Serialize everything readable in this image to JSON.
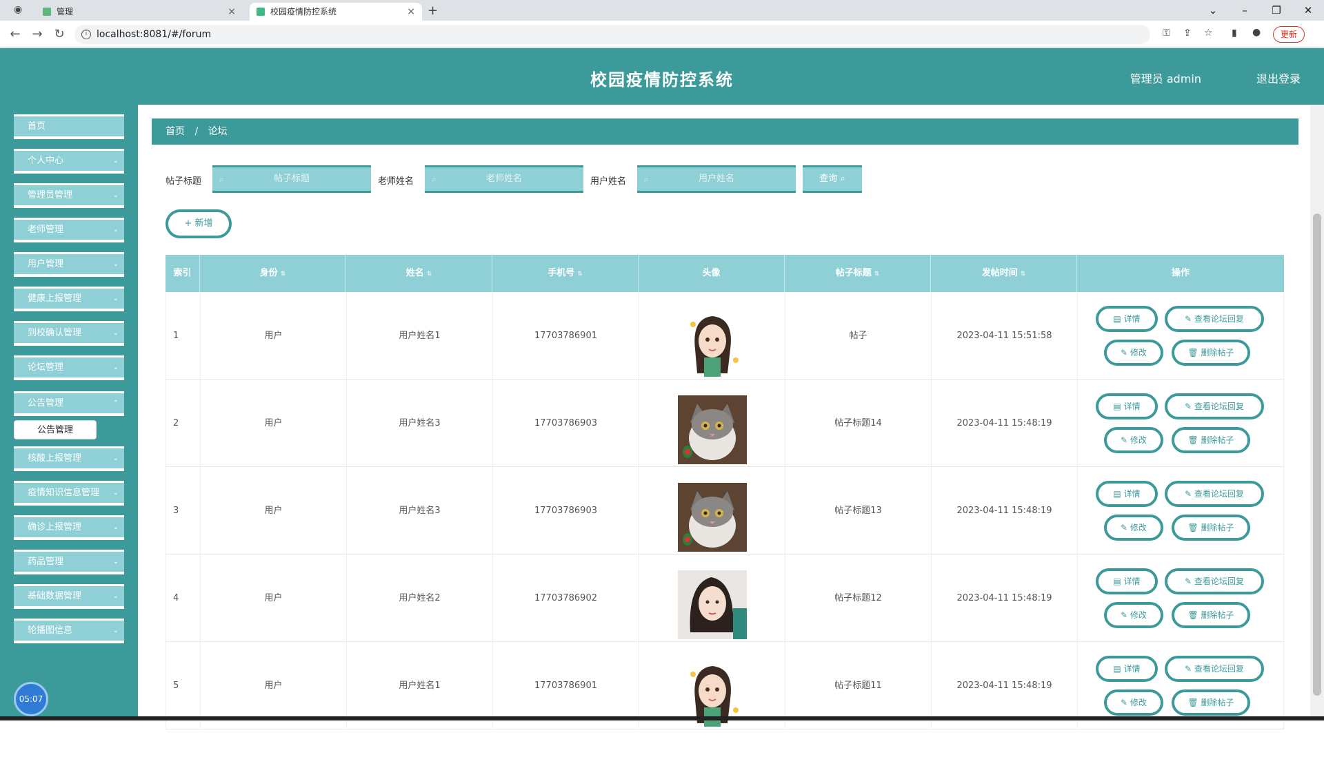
{
  "browser": {
    "tabs": [
      {
        "label": "管理",
        "active": false
      },
      {
        "label": "校园疫情防控系统",
        "active": true
      }
    ],
    "url": "localhost:8081/#/forum",
    "update_label": "更新",
    "new_tab_glyph": "+"
  },
  "header": {
    "title": "校园疫情防控系统",
    "admin_label": "管理员 admin",
    "logout_label": "退出登录"
  },
  "sidebar": {
    "items": [
      {
        "label": "首页",
        "has_children": false
      },
      {
        "label": "个人中心",
        "has_children": true
      },
      {
        "label": "管理员管理",
        "has_children": true
      },
      {
        "label": "老师管理",
        "has_children": true
      },
      {
        "label": "用户管理",
        "has_children": true
      },
      {
        "label": "健康上报管理",
        "has_children": true
      },
      {
        "label": "到校确认管理",
        "has_children": true
      },
      {
        "label": "论坛管理",
        "has_children": true
      },
      {
        "label": "公告管理",
        "has_children": true
      },
      {
        "label": "核酸上报管理",
        "has_children": true
      },
      {
        "label": "疫情知识信息管理",
        "has_children": true
      },
      {
        "label": "确诊上报管理",
        "has_children": true
      },
      {
        "label": "药品管理",
        "has_children": true
      },
      {
        "label": "基础数据管理",
        "has_children": true
      },
      {
        "label": "轮播图信息",
        "has_children": true
      }
    ],
    "open_submenu": "公告管理",
    "clock": "05:07"
  },
  "breadcrumb": {
    "home": "首页",
    "separator": "/",
    "current": "论坛"
  },
  "search": {
    "title_label": "帖子标题",
    "title_placeholder": "帖子标题",
    "teacher_label": "老师姓名",
    "teacher_placeholder": "老师姓名",
    "user_label": "用户姓名",
    "user_placeholder": "用户姓名",
    "button_label": "查询"
  },
  "add_button": "新增",
  "table": {
    "columns": [
      "索引",
      "身份",
      "姓名",
      "手机号",
      "头像",
      "帖子标题",
      "发帖时间",
      "操作"
    ],
    "rows": [
      {
        "index": "1",
        "role": "用户",
        "name": "用户姓名1",
        "phone": "17703786901",
        "avatar": "girl-avatar",
        "title": "帖子",
        "time": "2023-04-11 15:51:58"
      },
      {
        "index": "2",
        "role": "用户",
        "name": "用户姓名3",
        "phone": "17703786903",
        "avatar": "cat-avatar",
        "title": "帖子标题14",
        "time": "2023-04-11 15:48:19"
      },
      {
        "index": "3",
        "role": "用户",
        "name": "用户姓名3",
        "phone": "17703786903",
        "avatar": "cat-avatar",
        "title": "帖子标题13",
        "time": "2023-04-11 15:48:19"
      },
      {
        "index": "4",
        "role": "用户",
        "name": "用户姓名2",
        "phone": "17703786902",
        "avatar": "woman-avatar",
        "title": "帖子标题12",
        "time": "2023-04-11 15:48:19"
      },
      {
        "index": "5",
        "role": "用户",
        "name": "用户姓名1",
        "phone": "17703786901",
        "avatar": "girl-avatar",
        "title": "帖子标题11",
        "time": "2023-04-11 15:48:19"
      }
    ],
    "actions": {
      "detail": "详情",
      "view_replies": "查看论坛回复",
      "edit": "修改",
      "delete": "删除帖子"
    }
  },
  "colors": {
    "primary": "#3d9a9b",
    "light": "#8fd0d6"
  }
}
